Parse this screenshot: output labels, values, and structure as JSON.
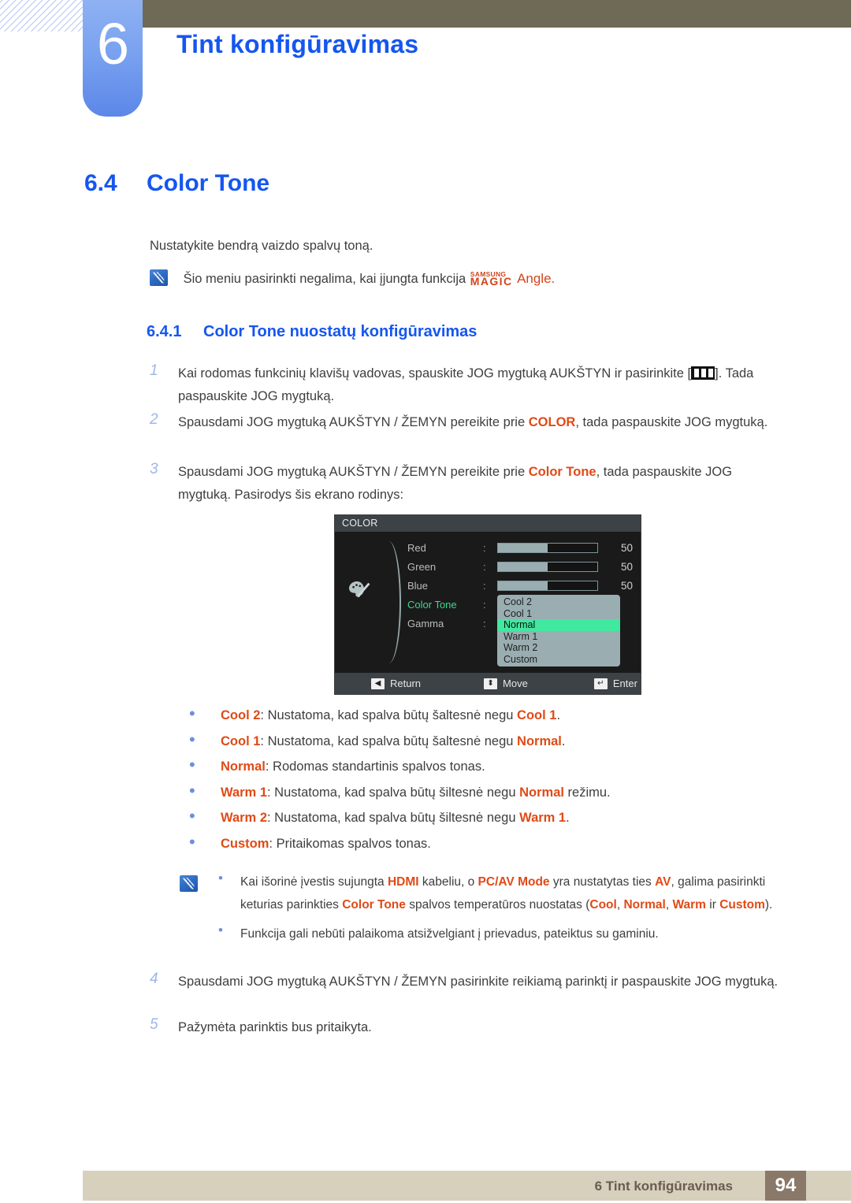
{
  "chapter": {
    "number": "6",
    "title": "Tint  konfigūravimas"
  },
  "section": {
    "number": "6.4",
    "title": "Color Tone"
  },
  "intro": "Nustatykite bendrą vaizdo spalvų toną.",
  "top_note": {
    "text_before": "Šio meniu pasirinkti negalima, kai įjungta funkcija",
    "magic_line1": "SAMSUNG",
    "magic_line2": "MAGIC",
    "magic_suffix": "Angle."
  },
  "subsection": {
    "number": "6.4.1",
    "title": "Color Tone nuostatų konfigūravimas"
  },
  "steps": [
    {
      "num": "1",
      "part1": "Kai rodomas funkcinių klavišų vadovas, spauskite JOG mygtuką AUKŠTYN ir pasirinkite [",
      "part2": "]. Tada paspauskite JOG mygtuką."
    },
    {
      "num": "2",
      "part1": "Spausdami JOG mygtuką AUKŠTYN / ŽEMYN pereikite prie ",
      "highlight": "COLOR",
      "part2": ", tada paspauskite JOG mygtuką."
    },
    {
      "num": "3",
      "part1": "Spausdami JOG mygtuką AUKŠTYN / ŽEMYN pereikite prie ",
      "highlight": "Color Tone",
      "part2": ", tada paspauskite JOG mygtuką. Pasirodys šis ekrano rodinys:"
    },
    {
      "num": "4",
      "part1": "Spausdami JOG mygtuką AUKŠTYN / ŽEMYN pasirinkite reikiamą parinktį ir paspauskite JOG mygtuką.",
      "highlight": "",
      "part2": ""
    },
    {
      "num": "5",
      "part1": "Pažymėta parinktis bus pritaikyta.",
      "highlight": "",
      "part2": ""
    }
  ],
  "osd": {
    "title": "COLOR",
    "icon": "palette-icon",
    "rows": [
      {
        "label": "Red",
        "colon": ":",
        "value": "50",
        "fill_pct": 50,
        "type": "slider",
        "active": false
      },
      {
        "label": "Green",
        "colon": ":",
        "value": "50",
        "fill_pct": 50,
        "type": "slider",
        "active": false
      },
      {
        "label": "Blue",
        "colon": ":",
        "value": "50",
        "fill_pct": 50,
        "type": "slider",
        "active": false
      },
      {
        "label": "Color Tone",
        "colon": ":",
        "value": "",
        "fill_pct": 0,
        "type": "list",
        "active": true
      },
      {
        "label": "Gamma",
        "colon": ":",
        "value": "",
        "fill_pct": 0,
        "type": "none",
        "active": false
      }
    ],
    "dropdown": {
      "items": [
        "Cool 2",
        "Cool 1",
        "Normal",
        "Warm 1",
        "Warm 2",
        "Custom"
      ],
      "selected": "Normal",
      "selected_color": "#41e8a0"
    },
    "footer": [
      {
        "glyph": "◀",
        "label": "Return",
        "icon": "left-arrow-key-icon"
      },
      {
        "glyph": "⬍",
        "label": "Move",
        "icon": "up-down-arrow-key-icon"
      },
      {
        "glyph": "↵",
        "label": "Enter",
        "icon": "enter-key-icon"
      }
    ]
  },
  "bullets": [
    {
      "term": "Cool 2",
      "mid": ": Nustatoma, kad spalva būtų šaltesnė negu ",
      "term2": "Cool 1",
      "end": "."
    },
    {
      "term": "Cool 1",
      "mid": ": Nustatoma, kad spalva būtų šaltesnė negu ",
      "term2": "Normal",
      "end": "."
    },
    {
      "term": "Normal",
      "mid": ": Rodomas standartinis spalvos tonas.",
      "term2": "",
      "end": ""
    },
    {
      "term": "Warm 1",
      "mid": ": Nustatoma, kad spalva būtų šiltesnė negu ",
      "term2": "Normal",
      "end": " režimu."
    },
    {
      "term": "Warm 2",
      "mid": ": Nustatoma, kad spalva būtų šiltesnė negu ",
      "term2": "Warm 1",
      "end": "."
    },
    {
      "term": "Custom",
      "mid": ": Pritaikomas spalvos tonas.",
      "term2": "",
      "end": ""
    }
  ],
  "note_box": {
    "icon": "note-pencil-icon",
    "items": [
      {
        "a": "Kai išorinė įvestis sujungta ",
        "k1": "HDMI",
        "b": " kabeliu, o ",
        "k2": "PC/AV Mode",
        "c": " yra nustatytas ties ",
        "k3": "AV",
        "d": ", galima pasirinkti keturias parinkties ",
        "k4": "Color Tone",
        "e": " spalvos temperatūros nuostatas (",
        "k5": "Cool",
        "f": ", ",
        "k6": "Normal",
        "g": ", ",
        "k7": "Warm",
        "h": " ir ",
        "k8": "Custom",
        "i": ")."
      },
      {
        "plain": "Funkcija gali nebūti palaikoma atsižvelgiant į prievadus, pateiktus su gaminiu."
      }
    ]
  },
  "footer": {
    "label": "6 Tint  konfigūravimas",
    "page": "94"
  },
  "colors": {
    "heading_blue": "#1556ef",
    "accent_orange": "#e04a16",
    "magic_orange": "#d2441c",
    "chapter_blue": "#7aa2f0",
    "olive": "#6e6a55",
    "footer_bar": "#d6d0bd",
    "footer_page_box": "#8a7868",
    "osd_bg": "#1a1a1a",
    "osd_select_green": "#41e8a0",
    "osd_label_green": "#3ad98e"
  }
}
